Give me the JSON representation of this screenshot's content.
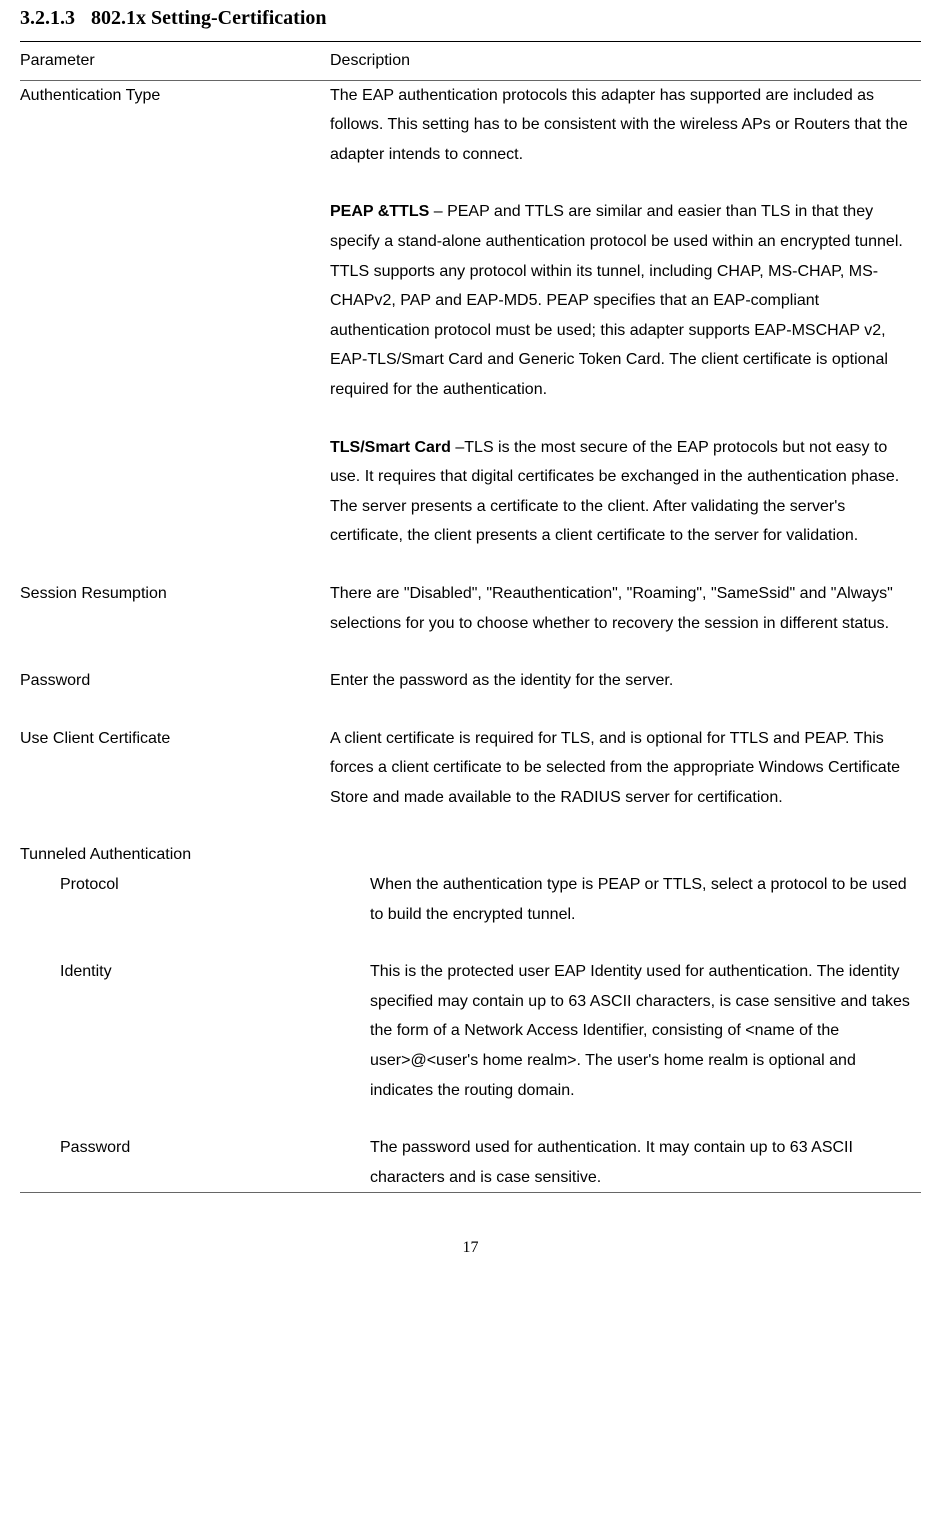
{
  "section": {
    "number": "3.2.1.3",
    "title": "802.1x Setting-Certification"
  },
  "table": {
    "headers": {
      "parameter": "Parameter",
      "description": "Description"
    },
    "rows": {
      "auth_type": {
        "param": "Authentication Type",
        "desc_intro": "The EAP authentication protocols this adapter has supported are included as follows. This setting has to be consistent with the wireless APs or Routers that the adapter intends to connect.",
        "peap_bold": "PEAP &TTLS",
        "peap_text": " – PEAP and TTLS are similar and easier than TLS in that they specify a stand-alone authentication protocol be used within an encrypted tunnel. TTLS supports any protocol within its tunnel, including CHAP, MS-CHAP, MS-CHAPv2, PAP and EAP-MD5. PEAP specifies that an EAP-compliant authentication protocol must be used; this adapter supports EAP-MSCHAP v2, EAP-TLS/Smart Card and Generic Token Card. The client certificate is optional required for the authentication.",
        "tls_bold": "TLS/Smart Card",
        "tls_text": " –TLS is the most secure of the EAP protocols but not easy to use. It requires that digital certificates be exchanged in the authentication phase. The server presents a certificate to the client. After validating the server's certificate, the client presents a client certificate to the server for validation."
      },
      "session_resumption": {
        "param": "Session Resumption",
        "desc": "There are \"Disabled\", \"Reauthentication\", \"Roaming\", \"SameSsid\" and \"Always\" selections for you to choose whether to recovery the session in different status."
      },
      "password": {
        "param": "Password",
        "desc": "Enter the password as the identity for the server."
      },
      "use_client_cert": {
        "param": "Use Client Certificate",
        "desc": "A client certificate is required for TLS, and is optional for TTLS and PEAP. This forces a client certificate to be selected from the appropriate Windows Certificate Store and made available to the RADIUS server for certification."
      },
      "tunneled_auth": {
        "param": "Tunneled Authentication"
      },
      "protocol": {
        "param": "Protocol",
        "desc": "When the authentication type is PEAP or TTLS, select a protocol to be used to build the encrypted tunnel."
      },
      "identity": {
        "param": "Identity",
        "desc": "This is the protected user EAP Identity used for authentication. The identity specified may contain up to 63 ASCII characters, is case sensitive and takes the form of a Network Access Identifier, consisting of <name of the user>@<user's home realm>. The user's home realm is optional and indicates the routing domain."
      },
      "password2": {
        "param": "Password",
        "desc": "The password used for authentication. It may contain up to 63 ASCII characters and is case sensitive."
      }
    }
  },
  "page_number": "17"
}
